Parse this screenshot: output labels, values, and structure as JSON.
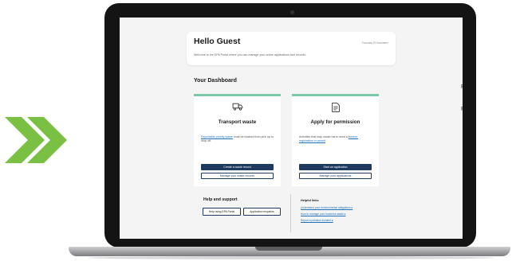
{
  "colors": {
    "chevron": "#7ac143",
    "accent_bar": "#7bc9a6",
    "primary_button": "#1f3a5f",
    "link": "#1d70b8",
    "screen_bg": "#f4f4f4",
    "bezel": "#141414"
  },
  "decoration": {
    "chevrons_icon": "double-chevron-right-icon"
  },
  "welcome": {
    "title": "Hello Guest",
    "subtitle": "Welcome to the EPA Portal where you can manage your online applications and records.",
    "date": "Thursday 20 November"
  },
  "dashboard": {
    "title": "Your Dashboard",
    "cards": [
      {
        "icon": "truck-icon",
        "title": "Transport waste",
        "desc_link": "Reportable priority waste",
        "desc_rest": " must be tracked from pick up to drop off.",
        "primary_label": "Create a waste record",
        "secondary_label": "Manage your waste records"
      },
      {
        "icon": "document-icon",
        "title": "Apply for permission",
        "desc_text": "Activities that may cause harm need a ",
        "desc_link": "licence, registration or permit",
        "desc_end": ".",
        "primary_label": "Start an application",
        "secondary_label": "Manage your applications"
      }
    ]
  },
  "help": {
    "title": "Help and support",
    "buttons": [
      "Help using EPA Portal",
      "Application enquiries"
    ]
  },
  "helpful_links": {
    "title": "Helpful links",
    "links": [
      "Understand your environmental obligations ▸",
      "How to manage your business waste ▸",
      "Report a pollution incident ▸"
    ]
  },
  "side_fragments": [
    "R",
    "P"
  ]
}
